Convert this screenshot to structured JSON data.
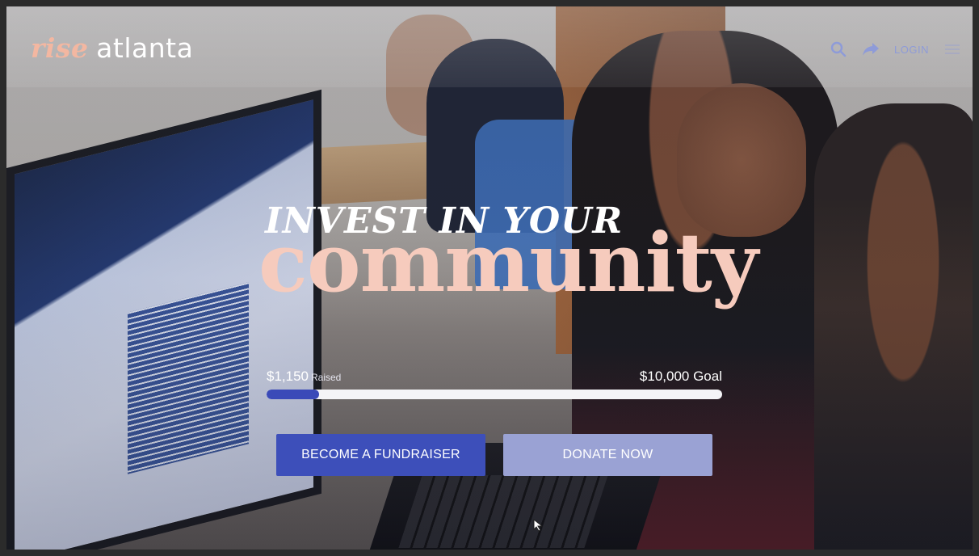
{
  "brand": {
    "part1": "rise",
    "part2": "atlanta"
  },
  "nav": {
    "login_label": "LOGIN",
    "search_icon": "search-icon",
    "share_icon": "share-icon"
  },
  "hero": {
    "line1": "INVEST IN YOUR",
    "line2": "community"
  },
  "fundraising": {
    "raised_amount": "$1,150",
    "raised_label": "Raised",
    "goal_text": "$10,000 Goal",
    "progress_fraction": 0.115
  },
  "actions": {
    "fundraiser_label": "BECOME A FUNDRAISER",
    "donate_label": "DONATE NOW"
  },
  "colors": {
    "accent_blue": "#3d4fba",
    "light_blue": "#9aa2d4",
    "peach": "#f6cbbd"
  }
}
